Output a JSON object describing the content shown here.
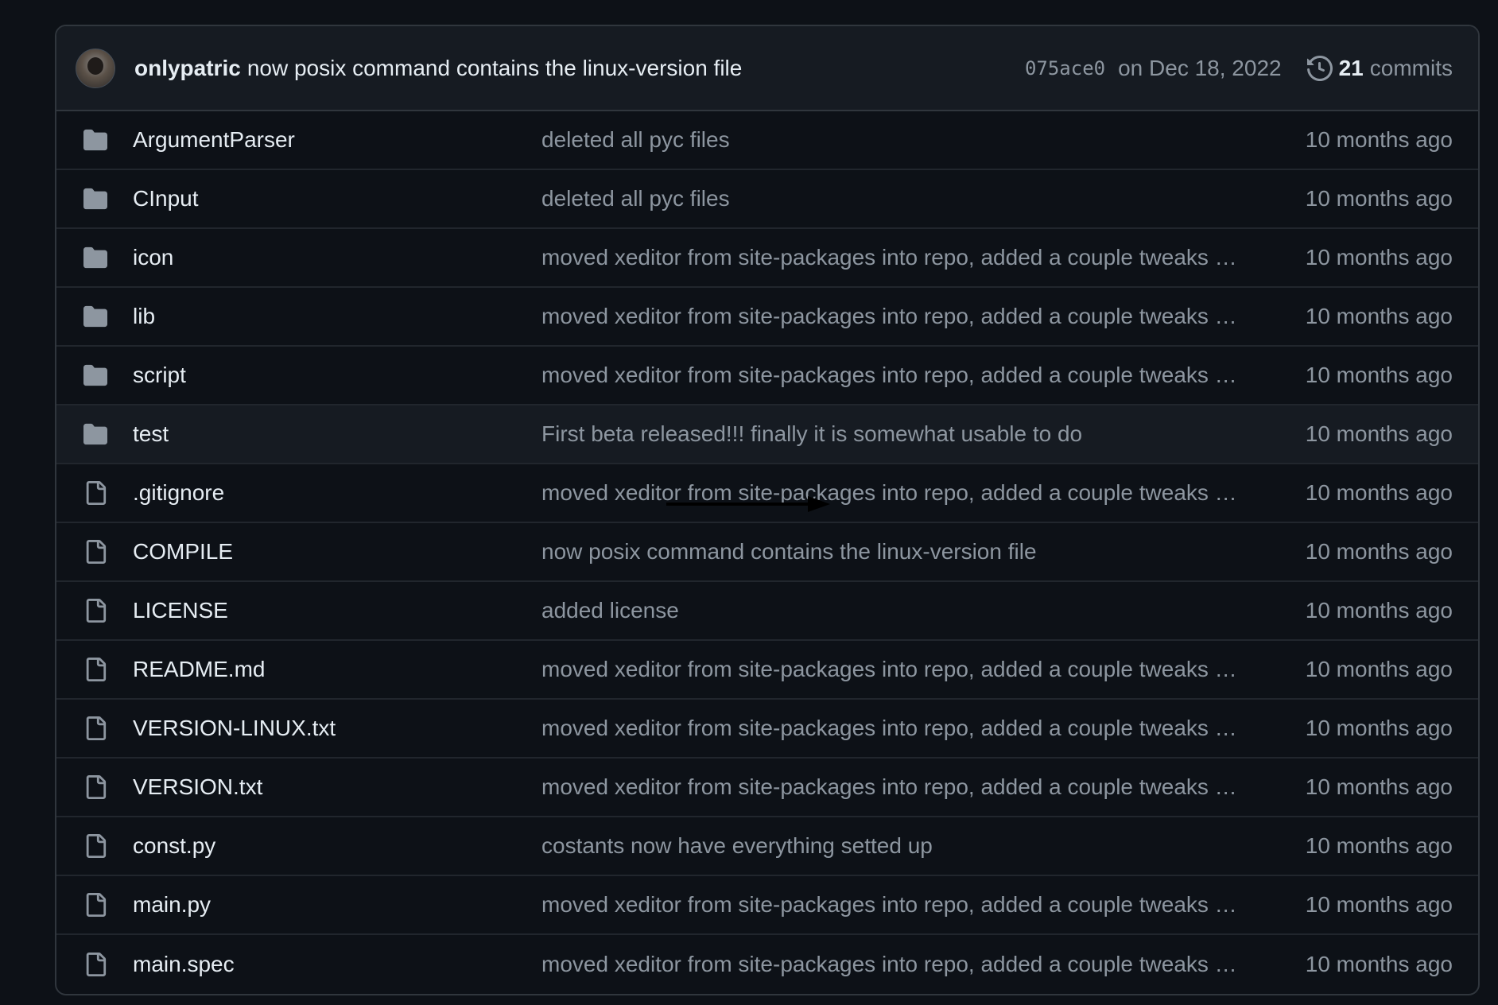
{
  "latest_commit": {
    "author": "onlypatric",
    "message": "now posix command contains the linux-version file",
    "sha": "075ace0",
    "date": "on Dec 18, 2022",
    "commits_count": "21",
    "commits_label": "commits"
  },
  "files": [
    {
      "name": "ArgumentParser",
      "type": "folder",
      "commit": "deleted all pyc files",
      "age": "10 months ago"
    },
    {
      "name": "CInput",
      "type": "folder",
      "commit": "deleted all pyc files",
      "age": "10 months ago"
    },
    {
      "name": "icon",
      "type": "folder",
      "commit": "moved xeditor from site-packages into repo, added a couple tweaks …",
      "age": "10 months ago"
    },
    {
      "name": "lib",
      "type": "folder",
      "commit": "moved xeditor from site-packages into repo, added a couple tweaks …",
      "age": "10 months ago"
    },
    {
      "name": "script",
      "type": "folder",
      "commit": "moved xeditor from site-packages into repo, added a couple tweaks …",
      "age": "10 months ago"
    },
    {
      "name": "test",
      "type": "folder",
      "commit": "First beta released!!! finally it is somewhat usable to do",
      "age": "10 months ago"
    },
    {
      "name": ".gitignore",
      "type": "file",
      "commit": "moved xeditor from site-packages into repo, added a couple tweaks …",
      "age": "10 months ago"
    },
    {
      "name": "COMPILE",
      "type": "file",
      "commit": "now posix command contains the linux-version file",
      "age": "10 months ago"
    },
    {
      "name": "LICENSE",
      "type": "file",
      "commit": "added license",
      "age": "10 months ago"
    },
    {
      "name": "README.md",
      "type": "file",
      "commit": "moved xeditor from site-packages into repo, added a couple tweaks …",
      "age": "10 months ago"
    },
    {
      "name": "VERSION-LINUX.txt",
      "type": "file",
      "commit": "moved xeditor from site-packages into repo, added a couple tweaks …",
      "age": "10 months ago"
    },
    {
      "name": "VERSION.txt",
      "type": "file",
      "commit": "moved xeditor from site-packages into repo, added a couple tweaks …",
      "age": "10 months ago"
    },
    {
      "name": "const.py",
      "type": "file",
      "commit": "costants now have everything setted up",
      "age": "10 months ago"
    },
    {
      "name": "main.py",
      "type": "file",
      "commit": "moved xeditor from site-packages into repo, added a couple tweaks …",
      "age": "10 months ago"
    },
    {
      "name": "main.spec",
      "type": "file",
      "commit": "moved xeditor from site-packages into repo, added a couple tweaks …",
      "age": "10 months ago"
    }
  ],
  "icons": {
    "folder": "folder-icon",
    "file": "file-icon",
    "history": "history-icon"
  },
  "colors": {
    "background": "#0d1117",
    "header": "#161b22",
    "border": "#30363d",
    "text": "#e6edf3",
    "muted": "#8d96a0",
    "folder": "#8d96a0"
  }
}
